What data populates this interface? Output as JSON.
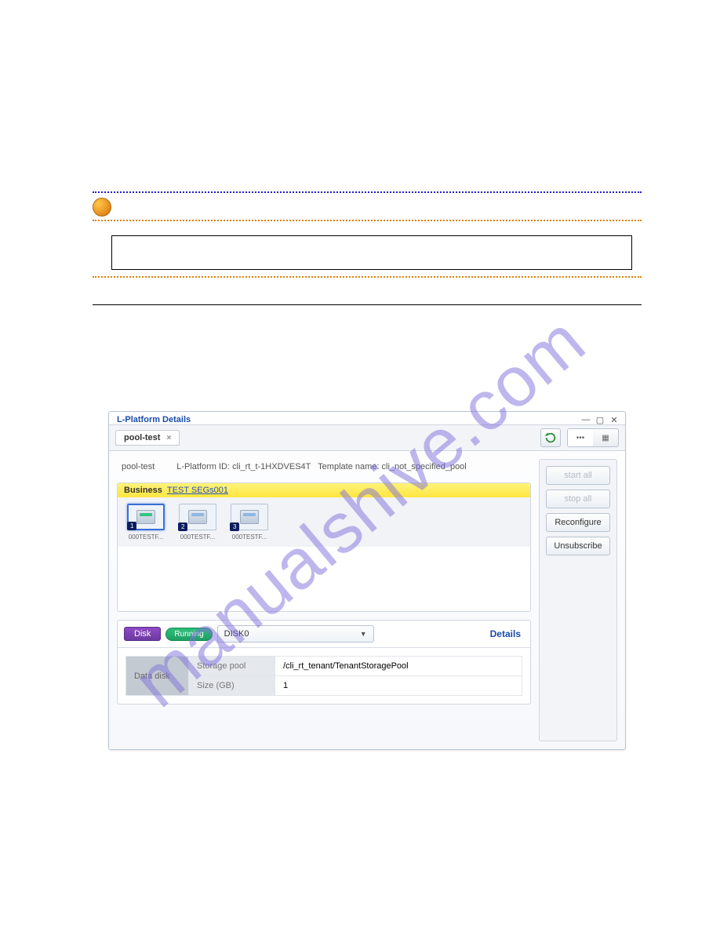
{
  "separators": {},
  "watermark_text": "manualshive.com",
  "app": {
    "title": "L-Platform Details",
    "tab": {
      "name": "pool-test"
    },
    "info": {
      "name": "pool-test",
      "lplatform_label": "L-Platform ID:",
      "lplatform_id": "cli_rt_t-1HXDVES4T",
      "template_label": "Template name:",
      "template_name": "cli_not_specified_pool"
    },
    "segment": {
      "category_label": "Business",
      "segment_link": "TEST SEGs001"
    },
    "nodes": [
      {
        "badge": "1",
        "label": "000TESTF..."
      },
      {
        "badge": "2",
        "label": "000TESTF..."
      },
      {
        "badge": "3",
        "label": "000TESTF..."
      }
    ],
    "side_buttons": {
      "start_all": "start all",
      "stop_all": "stop all",
      "reconfigure": "Reconfigure",
      "unsubscribe": "Unsubscribe"
    },
    "details": {
      "disk_tab": "Disk",
      "running_label": "Running",
      "disk_select_value": "DISK0",
      "details_link": "Details",
      "row_header": "Data disk",
      "storage_pool_label": "Storage pool",
      "storage_pool_value": "/cli_rt_tenant/TenantStoragePool",
      "size_label": "Size (GB)",
      "size_value": "1"
    },
    "view_toggle": {
      "left": "•••",
      "right": "▦"
    }
  }
}
